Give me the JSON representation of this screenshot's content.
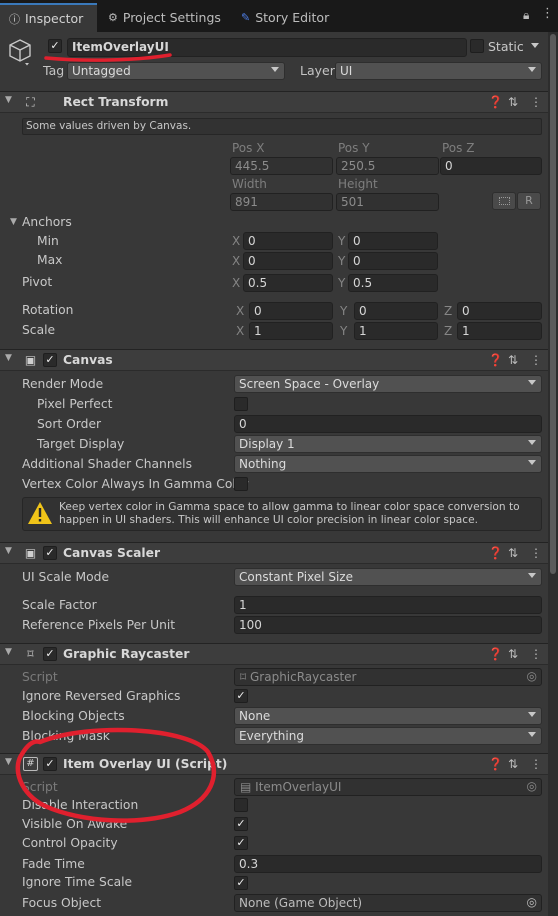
{
  "tabs": [
    {
      "label": "Inspector",
      "icon": "info-icon"
    },
    {
      "label": "Project Settings",
      "icon": "gear-icon"
    },
    {
      "label": "Story Editor",
      "icon": "story-icon"
    }
  ],
  "object": {
    "active": true,
    "name": "ItemOverlayUI",
    "static_label": "Static",
    "tag_label": "Tag",
    "tag_value": "Untagged",
    "layer_label": "Layer",
    "layer_value": "UI"
  },
  "rect_transform": {
    "title": "Rect Transform",
    "help": "Some values driven by Canvas.",
    "pos_x_label": "Pos X",
    "pos_y_label": "Pos Y",
    "pos_z_label": "Pos Z",
    "pos_x": "445.5",
    "pos_y": "250.5",
    "pos_z": "0",
    "width_label": "Width",
    "height_label": "Height",
    "width": "891",
    "height": "501",
    "r_button": "R",
    "anchors_label": "Anchors",
    "min_label": "Min",
    "min_x": "0",
    "min_y": "0",
    "max_label": "Max",
    "max_x": "0",
    "max_y": "0",
    "pivot_label": "Pivot",
    "pivot_x": "0.5",
    "pivot_y": "0.5",
    "rotation_label": "Rotation",
    "rot_x": "0",
    "rot_y": "0",
    "rot_z": "0",
    "scale_label": "Scale",
    "scale_x": "1",
    "scale_y": "1",
    "scale_z": "1",
    "x": "X",
    "y": "Y",
    "z": "Z"
  },
  "canvas": {
    "title": "Canvas",
    "enabled": true,
    "render_mode_label": "Render Mode",
    "render_mode": "Screen Space - Overlay",
    "pixel_perfect_label": "Pixel Perfect",
    "pixel_perfect": false,
    "sort_order_label": "Sort Order",
    "sort_order": "0",
    "target_display_label": "Target Display",
    "target_display": "Display 1",
    "shader_channels_label": "Additional Shader Channels",
    "shader_channels": "Nothing",
    "gamma_label": "Vertex Color Always In Gamma Color",
    "gamma": false,
    "warning": "Keep vertex color in Gamma space to allow gamma to linear color space conversion to happen in UI shaders. This will enhance UI color precision in linear color space."
  },
  "canvas_scaler": {
    "title": "Canvas Scaler",
    "enabled": true,
    "ui_scale_mode_label": "UI Scale Mode",
    "ui_scale_mode": "Constant Pixel Size",
    "scale_factor_label": "Scale Factor",
    "scale_factor": "1",
    "ref_ppu_label": "Reference Pixels Per Unit",
    "ref_ppu": "100"
  },
  "graphic_raycaster": {
    "title": "Graphic Raycaster",
    "enabled": true,
    "script_label": "Script",
    "script": "GraphicRaycaster",
    "ignore_reversed_label": "Ignore Reversed Graphics",
    "ignore_reversed": true,
    "blocking_objects_label": "Blocking Objects",
    "blocking_objects": "None",
    "blocking_mask_label": "Blocking Mask",
    "blocking_mask": "Everything"
  },
  "item_overlay": {
    "title": "Item Overlay UI (Script)",
    "enabled": true,
    "script_label": "Script",
    "script": "ItemOverlayUI",
    "disable_interaction_label": "Disable Interaction",
    "disable_interaction": false,
    "visible_on_awake_label": "Visible On Awake",
    "visible_on_awake": true,
    "control_opacity_label": "Control Opacity",
    "control_opacity": true,
    "fade_time_label": "Fade Time",
    "fade_time": "0.3",
    "ignore_time_scale_label": "Ignore Time Scale",
    "ignore_time_scale": true,
    "focus_object_label": "Focus Object",
    "focus_object": "None (Game Object)"
  },
  "colors": {
    "accent": "#3a79bb",
    "annotation": "#e0202e",
    "warning": "#f0c419"
  }
}
